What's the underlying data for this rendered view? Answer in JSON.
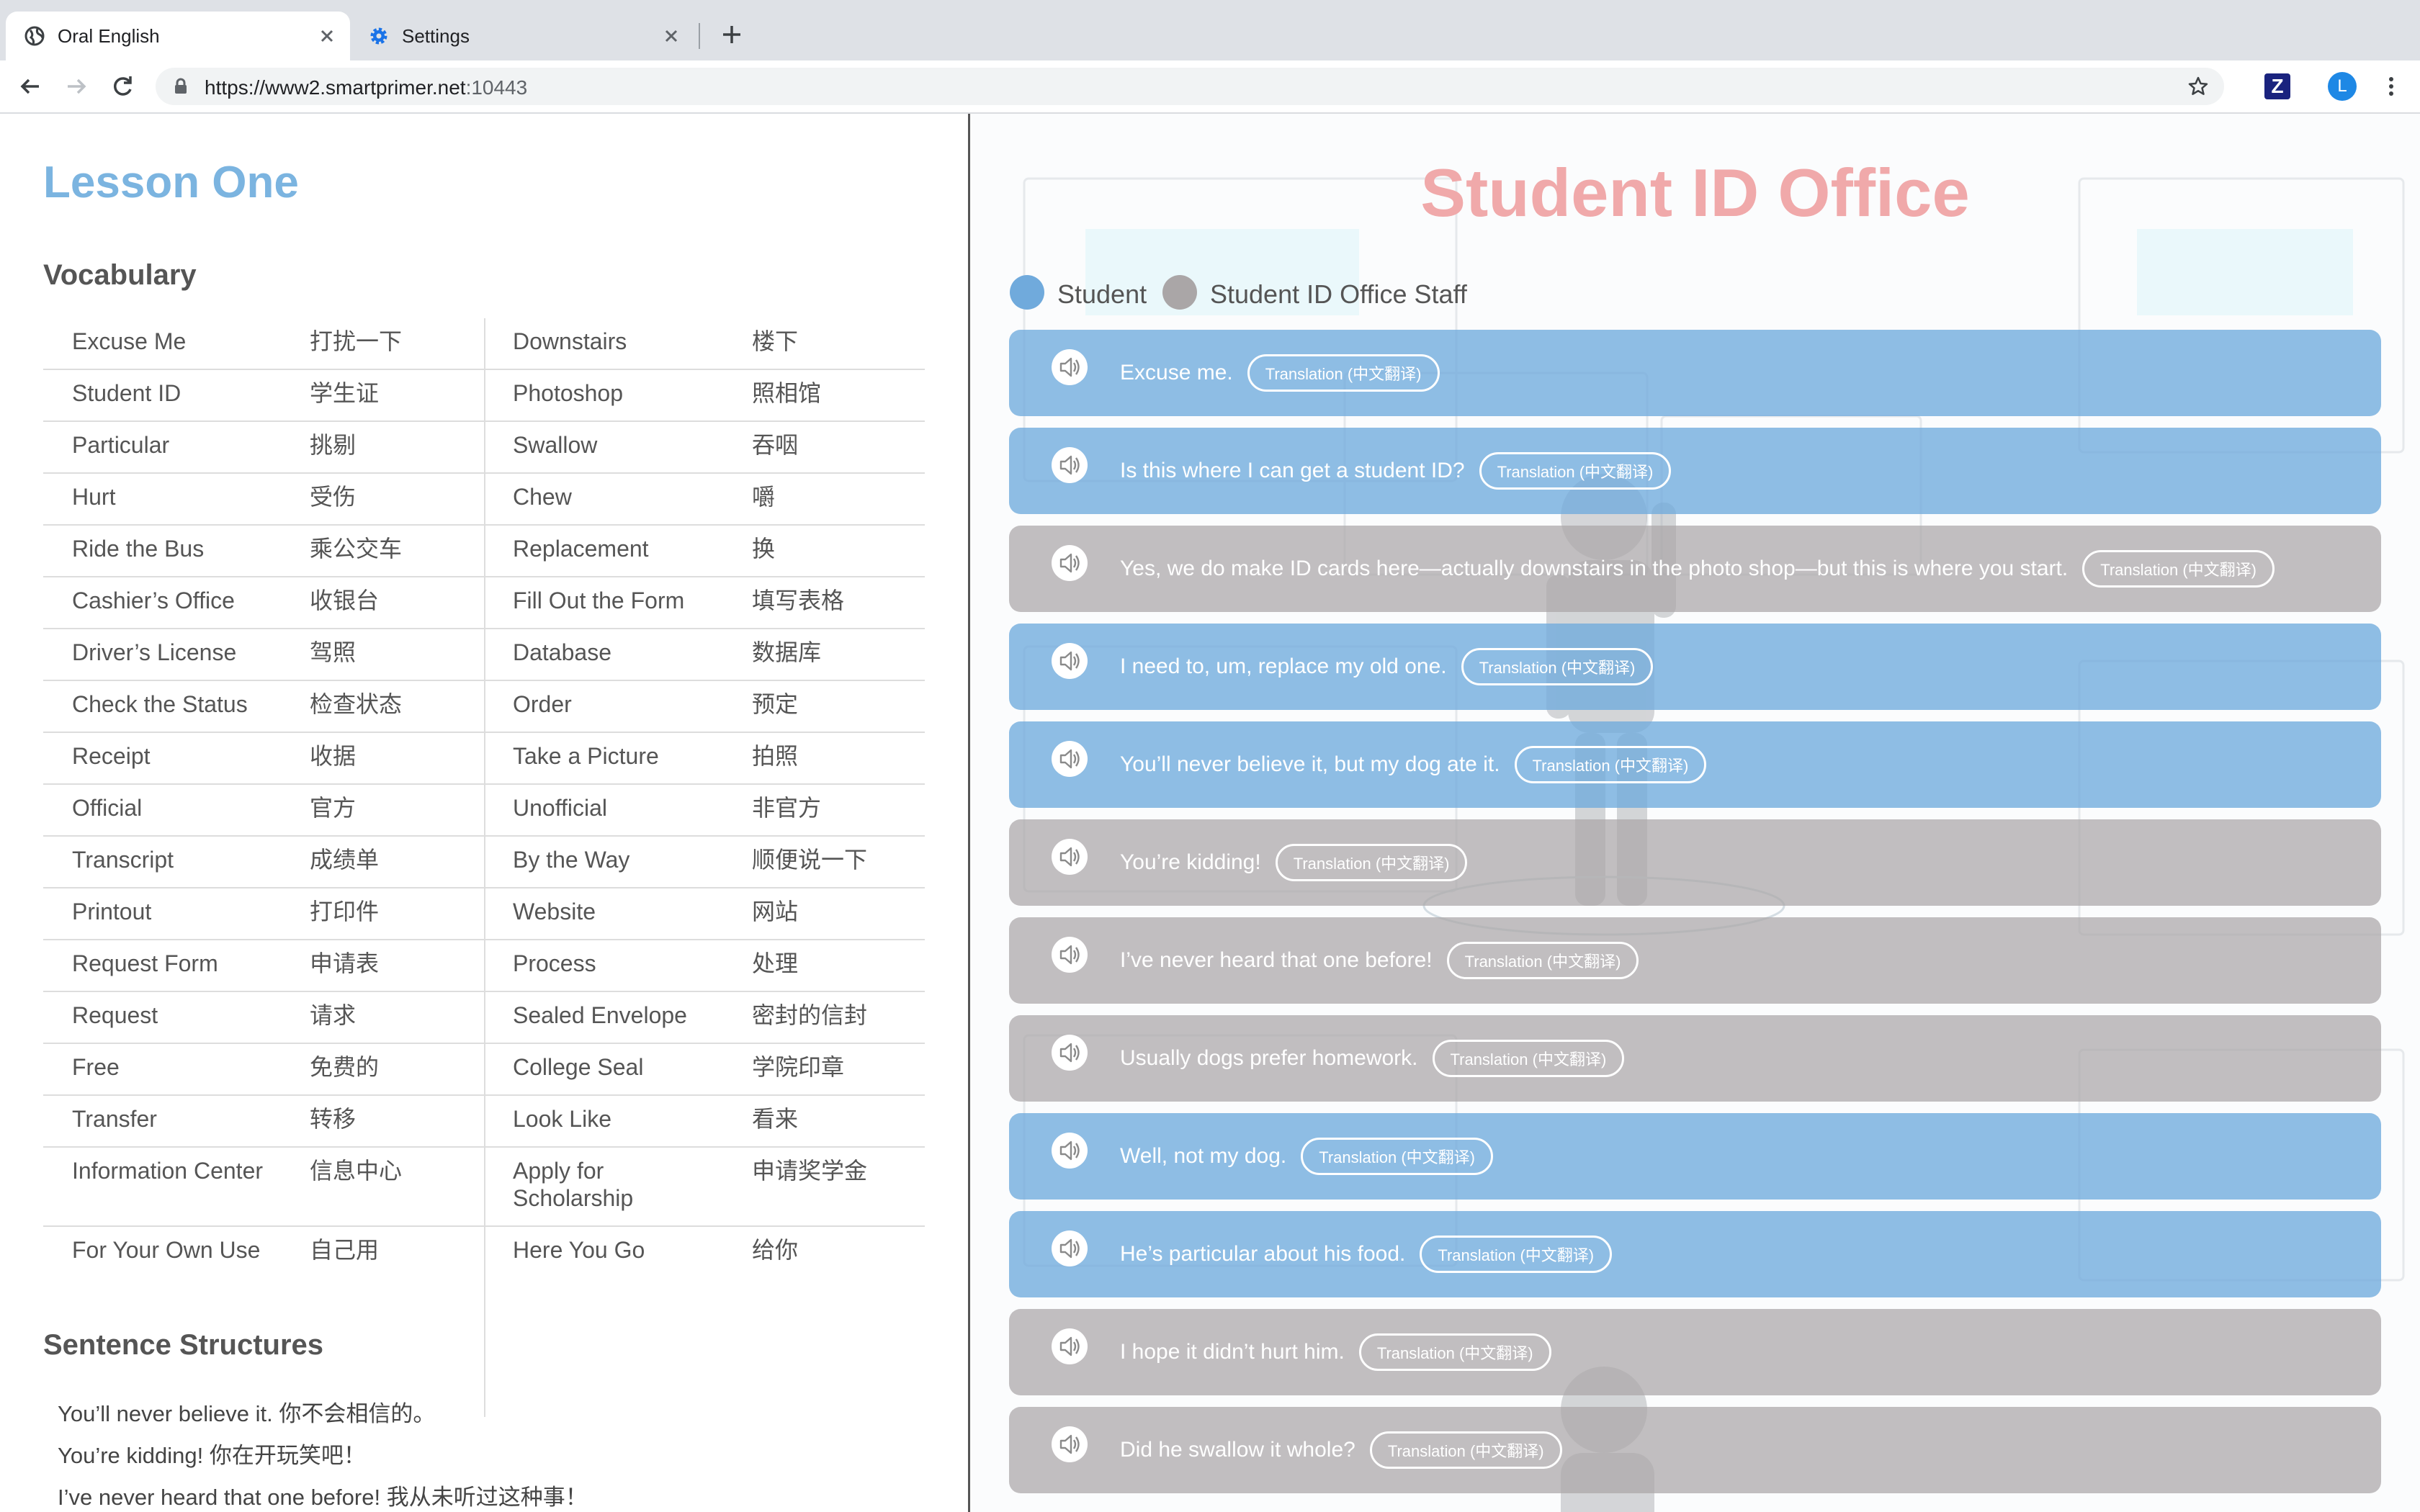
{
  "browser": {
    "tabs": [
      {
        "title": "Oral English",
        "icon": "globe-icon",
        "active": true
      },
      {
        "title": "Settings",
        "icon": "gear-icon",
        "active": false
      }
    ],
    "url": {
      "host": "https://www2.smartprimer.net",
      "port": ":10443"
    },
    "avatar_letter": "L",
    "extension_label": "Z"
  },
  "lesson": {
    "title": "Lesson One",
    "vocabulary_heading": "Vocabulary",
    "vocabulary": [
      [
        "Excuse Me",
        "打扰一下",
        "Downstairs",
        "楼下"
      ],
      [
        "Student ID",
        "学生证",
        "Photoshop",
        "照相馆"
      ],
      [
        "Particular",
        "挑剔",
        "Swallow",
        "吞咽"
      ],
      [
        "Hurt",
        "受伤",
        "Chew",
        "嚼"
      ],
      [
        "Ride the Bus",
        "乘公交车",
        "Replacement",
        "换"
      ],
      [
        "Cashier’s Office",
        "收银台",
        "Fill Out the Form",
        "填写表格"
      ],
      [
        "Driver’s License",
        "驾照",
        "Database",
        "数据库"
      ],
      [
        "Check the Status",
        "检查状态",
        "Order",
        "预定"
      ],
      [
        "Receipt",
        "收据",
        "Take a Picture",
        "拍照"
      ],
      [
        "Official",
        "官方",
        "Unofficial",
        "非官方"
      ],
      [
        "Transcript",
        "成绩单",
        "By the Way",
        "顺便说一下"
      ],
      [
        "Printout",
        "打印件",
        "Website",
        "网站"
      ],
      [
        "Request Form",
        "申请表",
        "Process",
        "处理"
      ],
      [
        "Request",
        "请求",
        "Sealed Envelope",
        "密封的信封"
      ],
      [
        "Free",
        "免费的",
        "College Seal",
        "学院印章"
      ],
      [
        "Transfer",
        "转移",
        "Look Like",
        "看来"
      ],
      [
        "Information Center",
        "信息中心",
        "Apply for Scholarship",
        "申请奖学金"
      ],
      [
        "For Your Own Use",
        "自己用",
        "Here You Go",
        "给你"
      ]
    ],
    "sentence_heading": "Sentence Structures",
    "sentences": [
      "You’ll never believe it. 你不会相信的。",
      "You’re kidding! 你在开玩笑吧！",
      "I’ve never heard that one before! 我从未听过这种事！"
    ]
  },
  "dialogue": {
    "title": "Student ID Office",
    "legend": {
      "student": "Student",
      "staff": "Student ID Office Staff"
    },
    "colors": {
      "student": "#70aadc",
      "staff": "#aaa6a7",
      "title": "#f0a9aa"
    },
    "translation_label": "Translation (中文翻译)",
    "lines": [
      {
        "speaker": "student",
        "text": "Excuse me."
      },
      {
        "speaker": "student",
        "text": "Is this where I can get a student ID?"
      },
      {
        "speaker": "staff",
        "text": "Yes, we do make ID cards here—actually downstairs in the photo shop—but this is where you start."
      },
      {
        "speaker": "student",
        "text": "I need to, um, replace my old one."
      },
      {
        "speaker": "student",
        "text": "You’ll never believe it, but my dog ate it."
      },
      {
        "speaker": "staff",
        "text": "You’re kidding!"
      },
      {
        "speaker": "staff",
        "text": "I’ve never heard that one before!"
      },
      {
        "speaker": "staff",
        "text": "Usually dogs prefer homework."
      },
      {
        "speaker": "student",
        "text": "Well, not my dog."
      },
      {
        "speaker": "student",
        "text": "He’s particular about his food."
      },
      {
        "speaker": "staff",
        "text": "I hope it didn’t hurt him."
      },
      {
        "speaker": "staff",
        "text": "Did he swallow it whole?"
      }
    ]
  }
}
